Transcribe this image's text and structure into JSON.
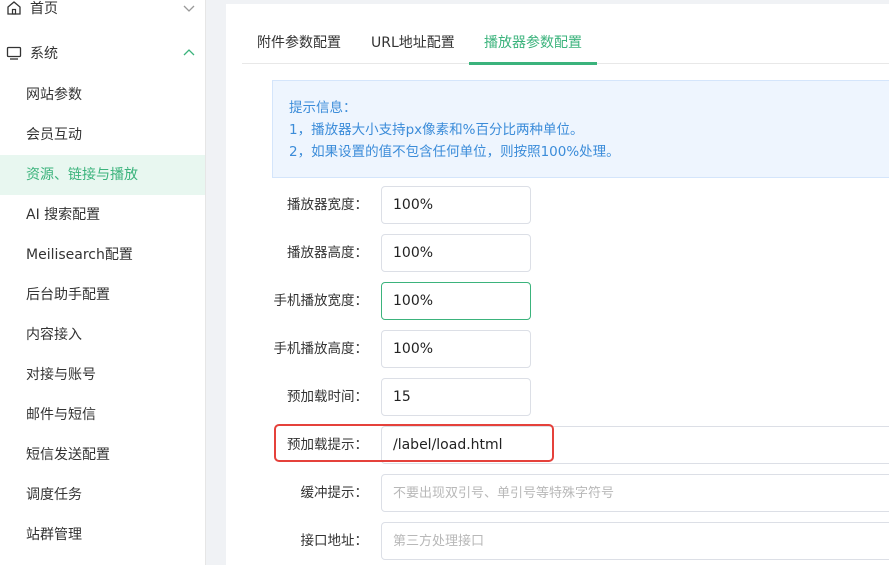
{
  "sidebar": {
    "top_items": [
      {
        "label": "首页",
        "icon": "home-icon",
        "expanded": false
      },
      {
        "label": "系统",
        "icon": "monitor-icon",
        "expanded": true
      }
    ],
    "sub_items": [
      {
        "label": "网站参数"
      },
      {
        "label": "会员互动"
      },
      {
        "label": "资源、链接与播放",
        "active": true
      },
      {
        "label": "AI 搜索配置"
      },
      {
        "label": "Meilisearch配置"
      },
      {
        "label": "后台助手配置"
      },
      {
        "label": "内容接入"
      },
      {
        "label": "对接与账号"
      },
      {
        "label": "邮件与短信"
      },
      {
        "label": "短信发送配置"
      },
      {
        "label": "调度任务"
      },
      {
        "label": "站群管理"
      }
    ]
  },
  "tabs": [
    {
      "label": "附件参数配置"
    },
    {
      "label": "URL地址配置"
    },
    {
      "label": "播放器参数配置",
      "active": true
    }
  ],
  "tip": {
    "title": "提示信息：",
    "lines": [
      "1，播放器大小支持px像素和%百分比两种单位。",
      "2，如果设置的值不包含任何单位，则按照100%处理。"
    ]
  },
  "form": {
    "player_width": {
      "label": "播放器宽度：",
      "value": "100%"
    },
    "player_height": {
      "label": "播放器高度：",
      "value": "100%"
    },
    "mobile_width": {
      "label": "手机播放宽度：",
      "value": "100%"
    },
    "mobile_height": {
      "label": "手机播放高度：",
      "value": "100%"
    },
    "preload_time": {
      "label": "预加载时间：",
      "value": "15"
    },
    "preload_tip": {
      "label": "预加载提示：",
      "value": "/label/load.html"
    },
    "buffer_tip": {
      "label": "缓冲提示：",
      "value": "",
      "placeholder": "不要出现双引号、单引号等特殊字符号"
    },
    "api_url": {
      "label": "接口地址：",
      "value": "",
      "placeholder": "第三方处理接口"
    }
  },
  "colors": {
    "accent": "#3bb37c",
    "tip_text": "#3b8cd9",
    "highlight": "#e5413b"
  }
}
